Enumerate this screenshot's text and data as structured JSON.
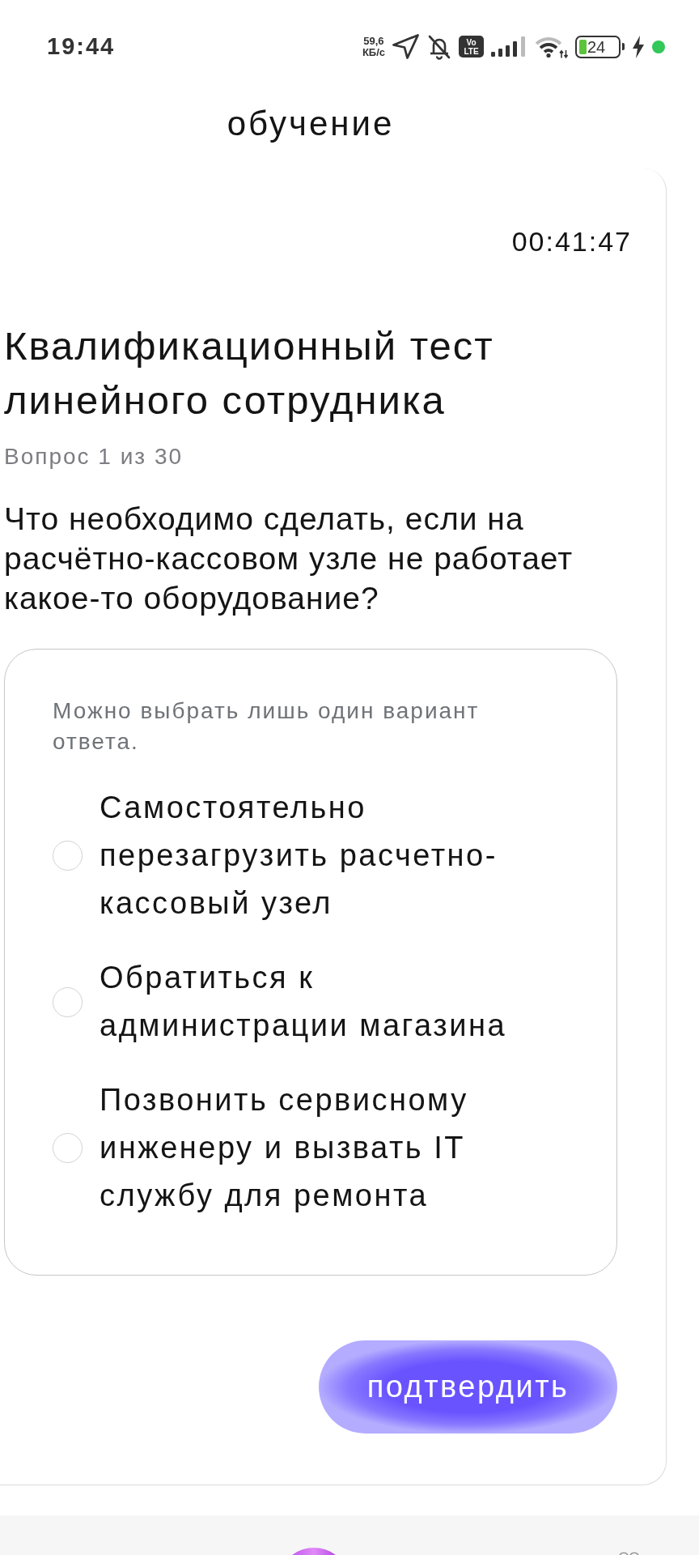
{
  "status_bar": {
    "time": "19:44",
    "net_speed_value": "59,6",
    "net_speed_unit": "КБ/с",
    "volte": [
      "Vo",
      "LTE"
    ],
    "battery": "24"
  },
  "header": {
    "title": "обучение"
  },
  "test": {
    "timer": "00:41:47",
    "title": "Квалификационный тест линейного сотрудника",
    "progress": "Вопрос 1 из 30",
    "question": "Что необходимо сделать, если на расчётно-кассовом узле не работает какое-то оборудование?",
    "hint": "Можно выбрать лишь один вариант ответа.",
    "options": [
      {
        "label": "Самостоятельно перезагрузить расчетно-кассовый узел",
        "selected": false
      },
      {
        "label": "Обратиться к администрации магазина",
        "selected": false
      },
      {
        "label": "Позвонить сервисному инженеру и вызвать IT службу для ремонта",
        "selected": false
      }
    ],
    "confirm_button": "подтвердить"
  }
}
